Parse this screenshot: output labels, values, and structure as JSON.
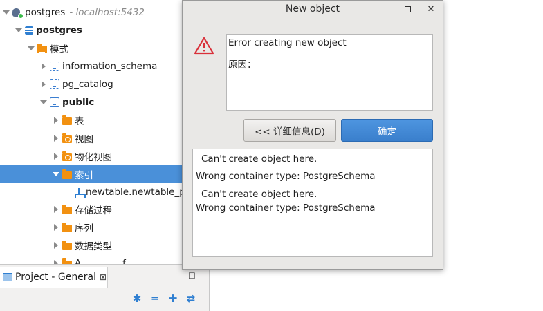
{
  "tree": {
    "connection": {
      "name": "postgres",
      "host": "localhost:5432"
    },
    "database": "postgres",
    "schemas_folder": "模式",
    "schema_information": "information_schema",
    "schema_pg_catalog": "pg_catalog",
    "schema_public": "public",
    "folder_tables": "表",
    "folder_views": "视图",
    "folder_matviews": "物化视图",
    "folder_indexes": "索引",
    "index_item": "newtable.newtable_p",
    "folder_procedures": "存储过程",
    "folder_sequences": "序列",
    "folder_datatypes": "数据类型",
    "folder_partial": "A........... ..f....... ..."
  },
  "project_panel": {
    "tab_label": "Project - General",
    "close_glyph": "⊠",
    "minimize_glyph": "—",
    "maximize_glyph": "☐"
  },
  "dialog": {
    "title": "New object",
    "maximize_glyph": "",
    "close_glyph": "✕",
    "message_line1": "Error creating new object",
    "message_line2": "原因：",
    "details_button": "<< 详细信息(D)",
    "ok_button": "确定",
    "details": [
      "Can't create object here.",
      "Wrong container type: PostgreSchema",
      "Can't create object here.",
      "Wrong container type: PostgreSchema"
    ]
  },
  "colors": {
    "selection": "#4a90d9",
    "accent_button": "#3a7fcc",
    "folder": "#f29111",
    "warning": "#d9303a"
  },
  "icons": {
    "connection": "postgres-connection-icon",
    "database": "database-icon",
    "schema": "schema-icon",
    "folder": "folder-icon",
    "index": "index-icon",
    "warning": "warning-triangle-icon",
    "project": "project-icon"
  }
}
